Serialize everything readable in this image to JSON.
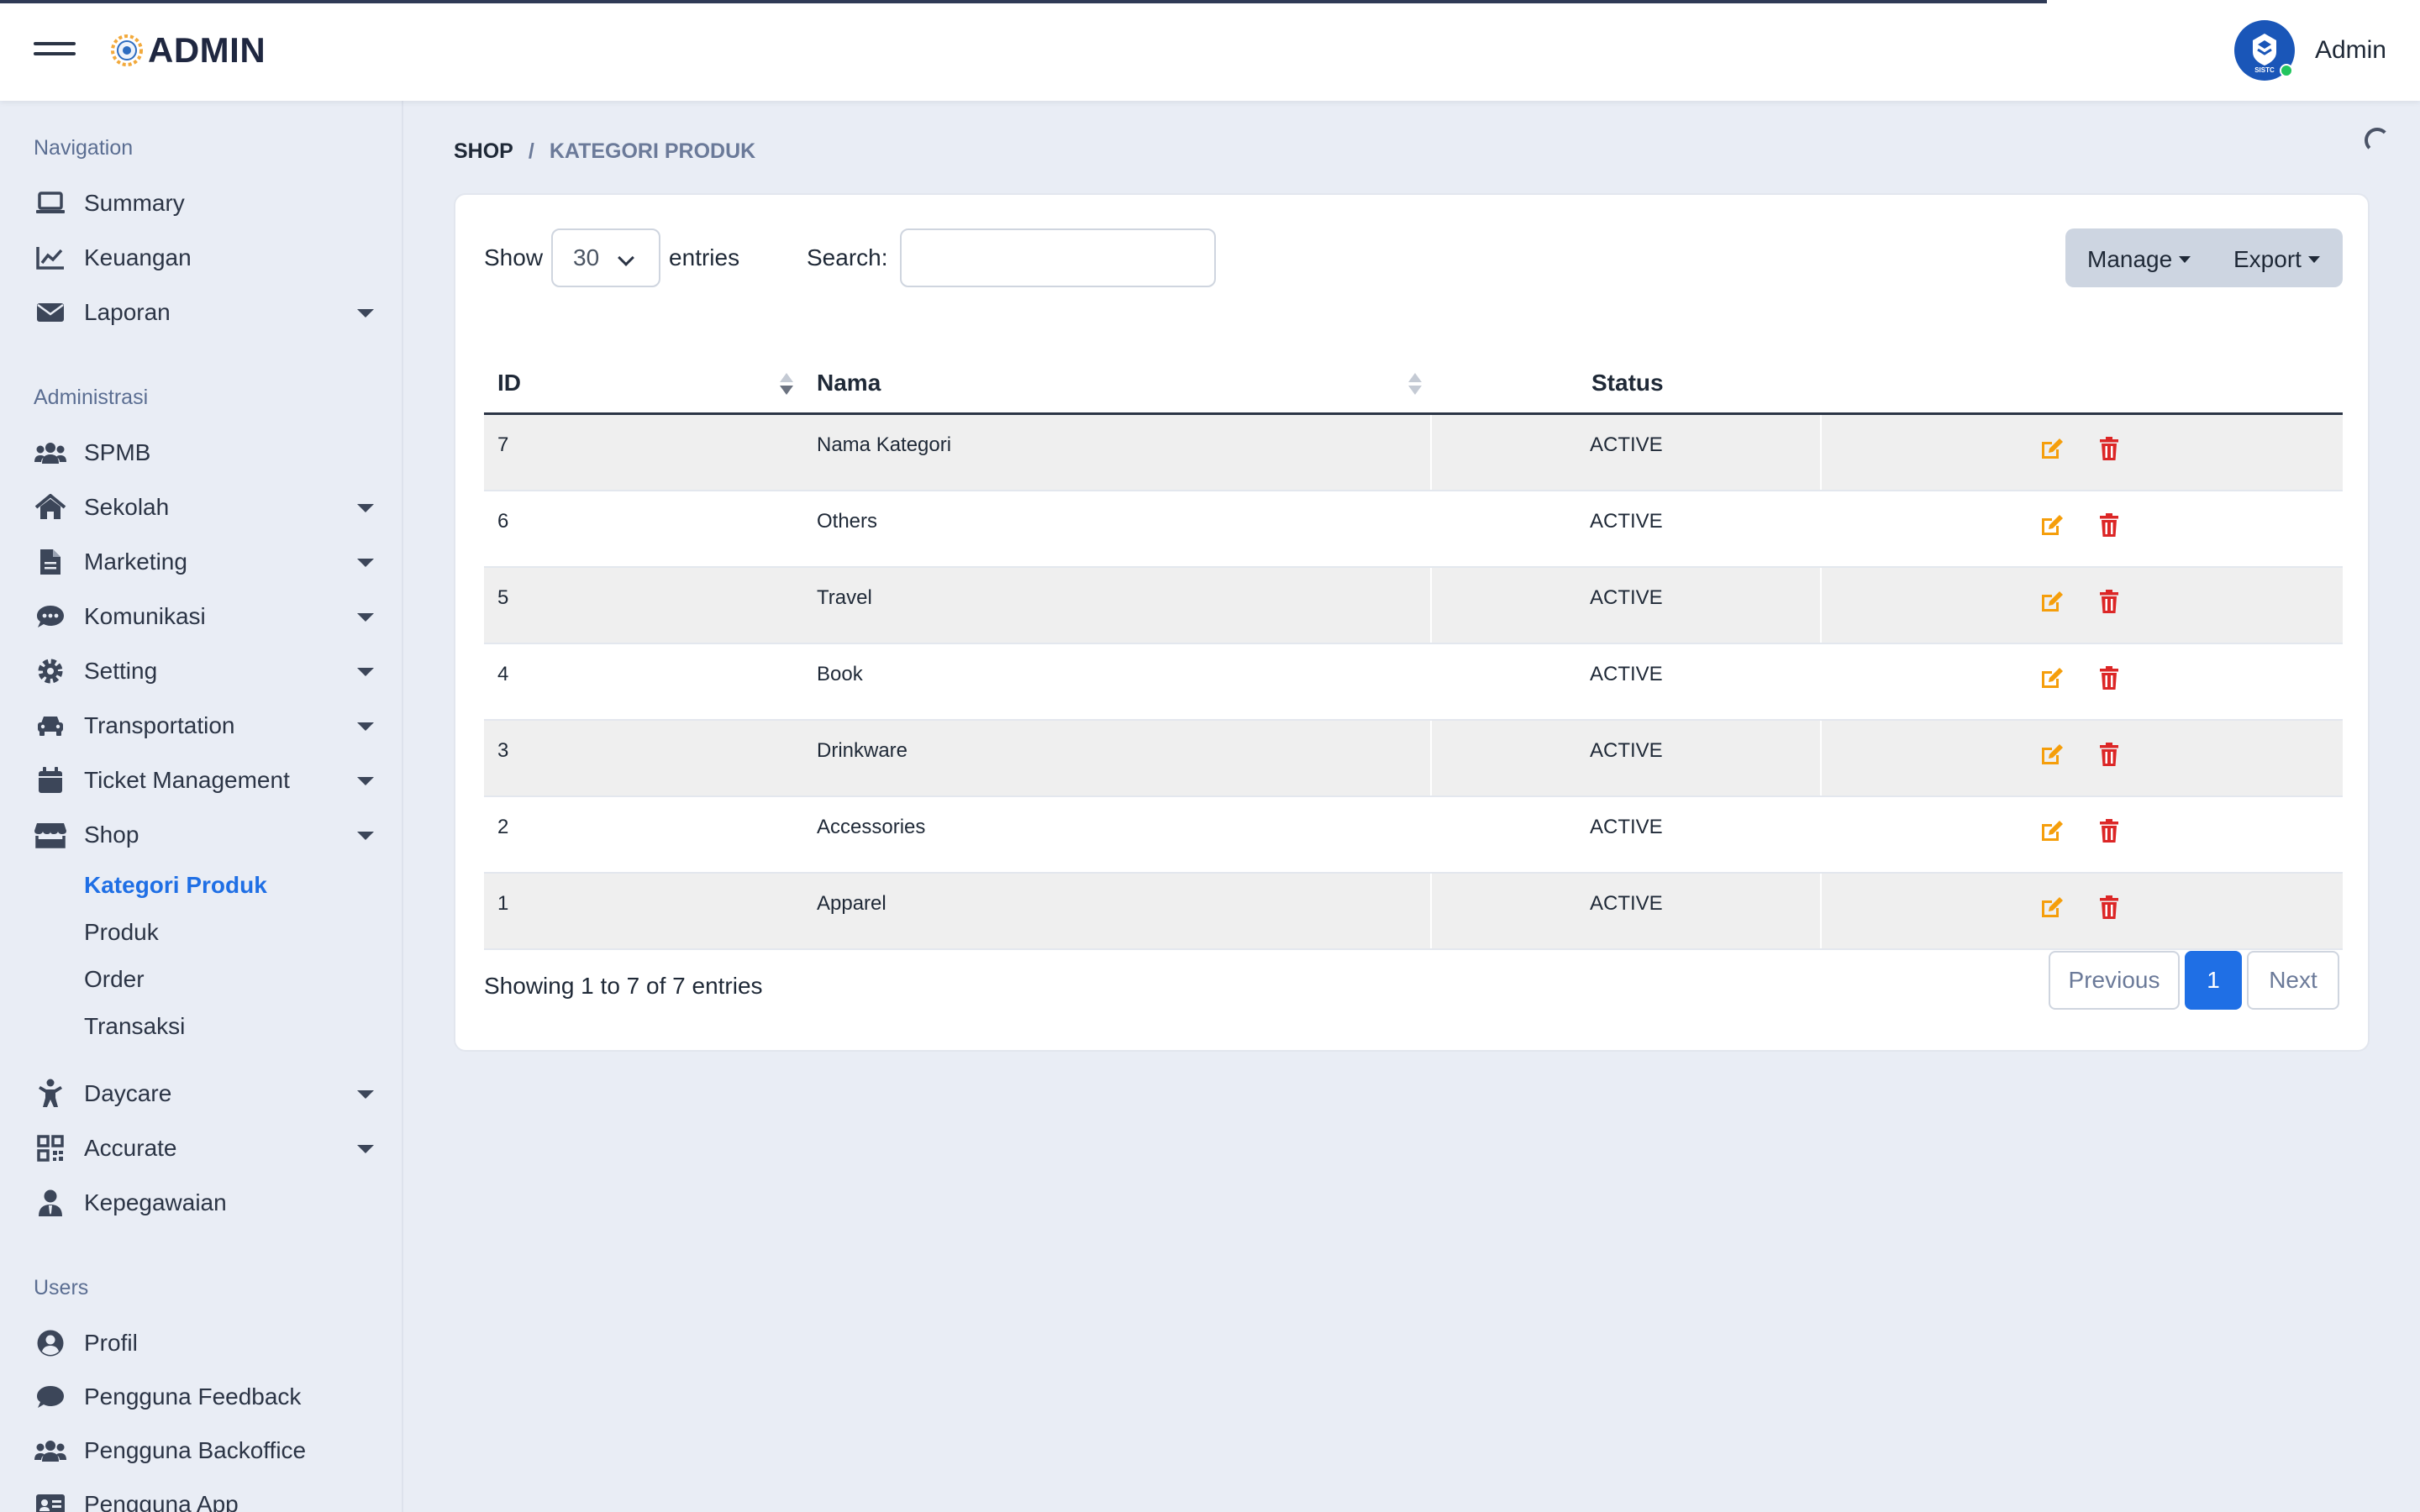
{
  "header": {
    "logo_text": "ADMIN",
    "user_name": "Admin",
    "avatar_text": "SISTC"
  },
  "sidebar": {
    "sections": [
      {
        "title": "Navigation"
      },
      {
        "title": "Administrasi"
      },
      {
        "title": "Users"
      }
    ],
    "items": [
      {
        "label": "Summary",
        "icon": "laptop-icon"
      },
      {
        "label": "Keuangan",
        "icon": "chart-line-icon"
      },
      {
        "label": "Laporan",
        "icon": "envelope-icon"
      },
      {
        "label": "SPMB",
        "icon": "users-icon"
      },
      {
        "label": "Sekolah",
        "icon": "home-icon"
      },
      {
        "label": "Marketing",
        "icon": "file-icon"
      },
      {
        "label": "Komunikasi",
        "icon": "comment-dots-icon"
      },
      {
        "label": "Setting",
        "icon": "gear-icon"
      },
      {
        "label": "Transportation",
        "icon": "car-icon"
      },
      {
        "label": "Ticket Management",
        "icon": "calendar-icon"
      },
      {
        "label": "Shop",
        "icon": "store-icon"
      },
      {
        "label": "Daycare",
        "icon": "child-icon"
      },
      {
        "label": "Accurate",
        "icon": "qrcode-icon"
      },
      {
        "label": "Kepegawaian",
        "icon": "user-tie-icon"
      },
      {
        "label": "Profil",
        "icon": "user-circle-icon"
      },
      {
        "label": "Pengguna Feedback",
        "icon": "comment-icon"
      },
      {
        "label": "Pengguna Backoffice",
        "icon": "users-icon"
      },
      {
        "label": "Pengguna App",
        "icon": "id-card-icon"
      }
    ],
    "shop_sub": [
      {
        "label": "Kategori Produk",
        "active": true
      },
      {
        "label": "Produk"
      },
      {
        "label": "Order"
      },
      {
        "label": "Transaksi"
      }
    ]
  },
  "breadcrumb": {
    "parent": "SHOP",
    "separator": "/",
    "current": "KATEGORI PRODUK"
  },
  "controls": {
    "show_label": "Show",
    "entries_value": "30",
    "entries_label": "entries",
    "search_label": "Search:",
    "search_value": "",
    "manage_label": "Manage",
    "export_label": "Export"
  },
  "table": {
    "columns": [
      "ID",
      "Nama",
      "Status"
    ],
    "rows": [
      {
        "id": "7",
        "nama": "Nama Kategori",
        "status": "ACTIVE"
      },
      {
        "id": "6",
        "nama": "Others",
        "status": "ACTIVE"
      },
      {
        "id": "5",
        "nama": "Travel",
        "status": "ACTIVE"
      },
      {
        "id": "4",
        "nama": "Book",
        "status": "ACTIVE"
      },
      {
        "id": "3",
        "nama": "Drinkware",
        "status": "ACTIVE"
      },
      {
        "id": "2",
        "nama": "Accessories",
        "status": "ACTIVE"
      },
      {
        "id": "1",
        "nama": "Apparel",
        "status": "ACTIVE"
      }
    ]
  },
  "footer": {
    "info": "Showing 1 to 7 of 7 entries",
    "previous": "Previous",
    "current_page": "1",
    "next": "Next"
  },
  "colors": {
    "accent": "#1f6fe5",
    "edit": "#f59e0b",
    "delete": "#dc2626"
  }
}
